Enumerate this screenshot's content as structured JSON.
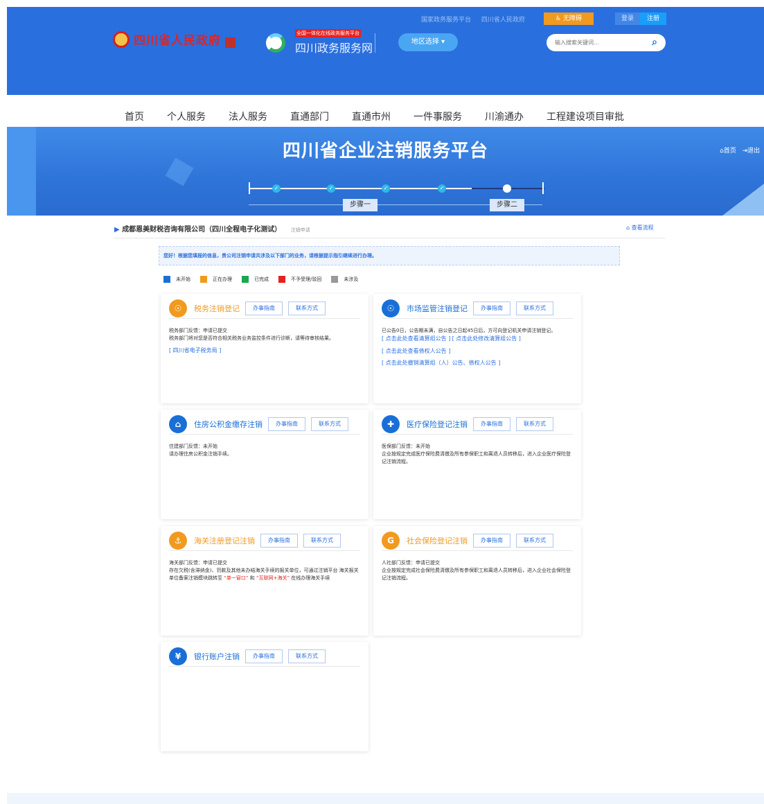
{
  "header": {
    "gov_name": "四川省人民政府",
    "platform_small": "全国一体化在线政务服务平台",
    "platform_name": "四川政务服务网",
    "region_label": "地区选择 ▾",
    "top_links": [
      "国家政务服务平台",
      "四川省人民政府"
    ],
    "accessibility": "无障碍",
    "login": "登录",
    "register": "注册",
    "search_placeholder": "输入搜索关键词...",
    "search_icon": "magnifier-icon",
    "brand_color": "#2a6fde"
  },
  "nav": [
    "首页",
    "个人服务",
    "法人服务",
    "直通部门",
    "直通市州",
    "一件事服务",
    "川渝通办",
    "工程建设项目审批"
  ],
  "banner": {
    "title": "四川省企业注销服务平台",
    "home": "⌂首页",
    "logout": "⇥退出",
    "step1": "步骤一",
    "step2": "步骤二"
  },
  "company": {
    "name": "成都恩美财税咨询有限公司（四川全程电子化测试）",
    "sub": "注销申请",
    "view_flow": "查看流程"
  },
  "notice": "您好！根据您填报的信息，贵公司注销申请共涉及以下部门的业务，请根据提示指引继续进行办理。",
  "legend": [
    {
      "label": "未开始",
      "color": "#1a6fd6"
    },
    {
      "label": "正在办理",
      "color": "#f19a20"
    },
    {
      "label": "已完成",
      "color": "#1aa84a"
    },
    {
      "label": "不予受理/驳回",
      "color": "#e5221f"
    },
    {
      "label": "未涉及",
      "color": "#999999"
    }
  ],
  "buttons": {
    "guide": "办事指南",
    "contact": "联系方式"
  },
  "cards": [
    {
      "name": "税务注销登记",
      "icon": "tax-emblem-icon",
      "status_color": "#f19a20",
      "lines": [
        "税务部门反馈：申请已提交",
        "税务部门将对您是否符合相关税务业务监控条件进行诊断，请等待审核结果。"
      ],
      "links": [
        "[ 四川省电子税务局 ]"
      ]
    },
    {
      "name": "市场监管注销登记",
      "icon": "market-emblem-icon",
      "status_color": "#1a6fd6",
      "lines": [
        "已公告0日，公告期未满，自公告之日起45日后，方可向登记机关申请注销登记。"
      ],
      "links": [
        "[ 点击此处查看清算组公告 ]",
        "[ 点击此处修改清算组公告 ]",
        "[ 点击此处查看债权人公告 ]",
        "[ 点击此处撤销清算组（人）公告、债权人公告 ]"
      ]
    },
    {
      "name": "住房公积金缴存注销",
      "icon": "housing-fund-icon",
      "status_color": "#1a6fd6",
      "lines": [
        "住建部门反馈：未开始",
        "请办理住房公积金注销手续。"
      ],
      "links": []
    },
    {
      "name": "医疗保险登记注销",
      "icon": "medical-insurance-icon",
      "status_color": "#1a6fd6",
      "lines": [
        "医保部门反馈：未开始",
        "企业按规定完成医疗保险费清缴及所有参保职工和离退人员转移后，进入企业医疗保险登记注销流程。"
      ],
      "links": []
    },
    {
      "name": "海关注册登记注销",
      "icon": "customs-icon",
      "status_color": "#f19a20",
      "lines": [
        "海关部门反馈：申请已提交",
        "存在欠税(含滞纳金)、罚款及其他未办结海关手续的报关单位，可通过注销平台 海关报关单位备案注销模块跳转至 "
      ],
      "hl1": "“单一窗口”",
      "mid": " 和 ",
      "hl2": "“互联网+海关”",
      "tail": " 在线办理海关手续",
      "links": []
    },
    {
      "name": "社会保险登记注销",
      "icon": "social-insurance-icon",
      "status_color": "#f19a20",
      "lines": [
        "人社部门反馈：申请已提交",
        "企业按规定完成社会保险费清缴及所有参保职工和离退人员转移后，进入企业社会保险登记注销流程。"
      ],
      "links": []
    },
    {
      "name": "银行账户注销",
      "icon": "bank-account-icon",
      "status_color": "#1a6fd6",
      "lines": [],
      "links": []
    }
  ]
}
